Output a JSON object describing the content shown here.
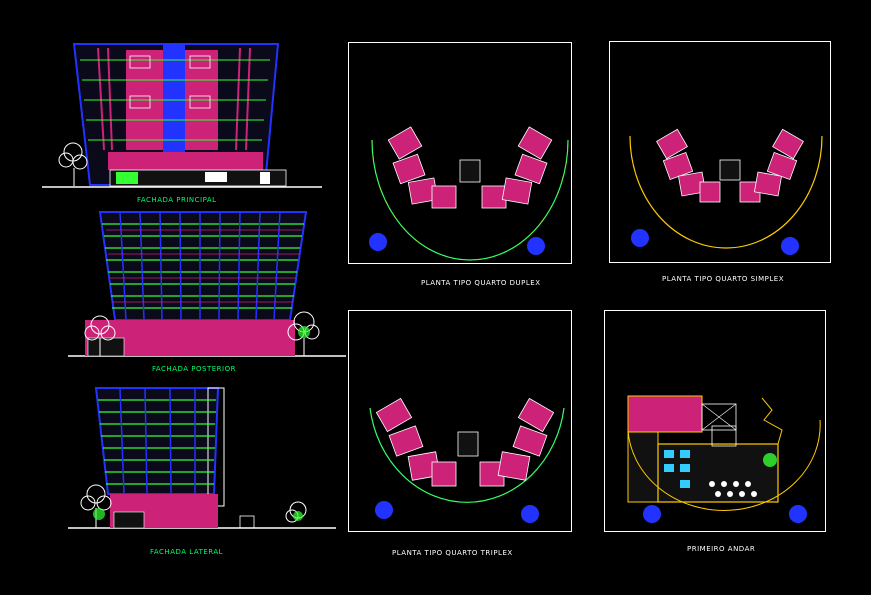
{
  "colors": {
    "background": "#000000",
    "frame": "#ffffff",
    "facade_label": "#00ff66",
    "plan_label": "#ffffff",
    "wall_blue": "#2233ff",
    "glass_green": "#33ff33",
    "room_magenta": "#cc2277",
    "arc_green": "#33ff66",
    "arc_yellow": "#ffcc00",
    "tree_white": "#ffffff"
  },
  "elevations": {
    "principal": {
      "label": "FACHADA PRINCIPAL"
    },
    "posterior": {
      "label": "FACHADA POSTERIOR"
    },
    "lateral": {
      "label": "FACHADA LATERAL"
    }
  },
  "plans": {
    "duplex": {
      "label": "PLANTA TIPO QUARTO DUPLEX"
    },
    "simplex": {
      "label": "PLANTA TIPO QUARTO SIMPLEX"
    },
    "triplex": {
      "label": "PLANTA TIPO QUARTO TRIPLEX"
    },
    "primeiro": {
      "label": "PRIMEIRO ANDAR"
    }
  }
}
